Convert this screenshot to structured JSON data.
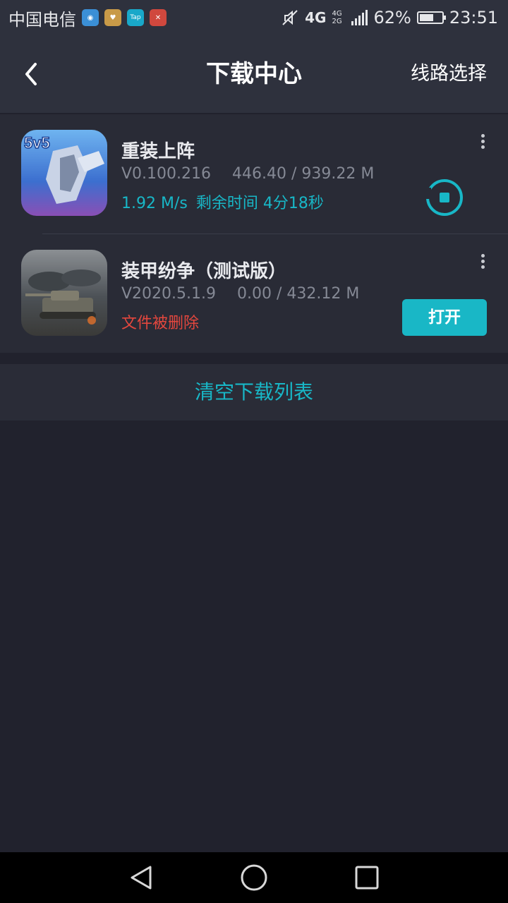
{
  "status_bar": {
    "carrier": "中国电信",
    "app_icons": [
      "app-icon-1",
      "app-icon-2",
      "tap-icon",
      "app-icon-4"
    ],
    "tap_label": "Tap",
    "network": "4G",
    "network_sub": "4G 2G",
    "battery": "62%",
    "battery_level": 0.62,
    "time": "23:51"
  },
  "header": {
    "title": "下载中心",
    "route_label": "线路选择"
  },
  "downloads": [
    {
      "name": "重装上阵",
      "version": "V0.100.216",
      "size": "446.40 / 939.22 M",
      "speed": "1.92 M/s",
      "status_label": "剩余时间 4分18秒",
      "action": "pause"
    },
    {
      "name": "装甲纷争（测试版）",
      "version": "V2020.5.1.9",
      "size": "0.00 / 432.12 M",
      "status_label": "文件被删除",
      "action_label": "打开"
    }
  ],
  "clear_label": "清空下载列表",
  "colors": {
    "accent": "#18b7c7",
    "error": "#e4473e",
    "background": "#21222d",
    "header": "#2e313d"
  }
}
